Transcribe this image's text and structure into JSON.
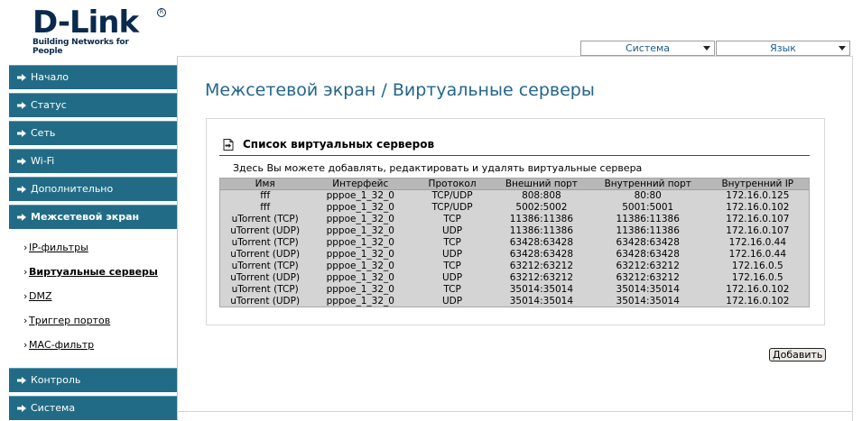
{
  "header": {
    "brand": "D-Link",
    "tagline": "Building Networks for People",
    "system_menu": "Система",
    "language_menu": "Язык"
  },
  "sidebar": {
    "items": [
      {
        "label": "Начало"
      },
      {
        "label": "Статус"
      },
      {
        "label": "Сеть"
      },
      {
        "label": "Wi-Fi"
      },
      {
        "label": "Дополнительно"
      },
      {
        "label": "Межсетевой экран"
      }
    ],
    "subitems": [
      {
        "label": "IP-фильтры"
      },
      {
        "label": "Виртуальные серверы"
      },
      {
        "label": "DMZ"
      },
      {
        "label": "Триггер портов"
      },
      {
        "label": "МАС-фильтр"
      }
    ],
    "bottom_items": [
      {
        "label": "Контроль"
      },
      {
        "label": "Система"
      }
    ]
  },
  "main": {
    "title": "Межсетевой экран /  Виртуальные серверы",
    "section_title": "Список виртуальных серверов",
    "section_desc": "Здесь Вы можете добавлять, редактировать и удалять виртуальные сервера",
    "add_label": "Добавить"
  },
  "table": {
    "columns": [
      "Имя",
      "Интерфейс",
      "Протокол",
      "Внешний порт",
      "Внутренний порт",
      "Внутренний IP"
    ],
    "rows": [
      [
        "fff",
        "pppoe_1_32_0",
        "TCP/UDP",
        "808:808",
        "80:80",
        "172.16.0.125"
      ],
      [
        "fff",
        "pppoe_1_32_0",
        "TCP/UDP",
        "5002:5002",
        "5001:5001",
        "172.16.0.102"
      ],
      [
        "uTorrent (TCP)",
        "pppoe_1_32_0",
        "TCP",
        "11386:11386",
        "11386:11386",
        "172.16.0.107"
      ],
      [
        "uTorrent (UDP)",
        "pppoe_1_32_0",
        "UDP",
        "11386:11386",
        "11386:11386",
        "172.16.0.107"
      ],
      [
        "uTorrent (TCP)",
        "pppoe_1_32_0",
        "TCP",
        "63428:63428",
        "63428:63428",
        "172.16.0.44"
      ],
      [
        "uTorrent (UDP)",
        "pppoe_1_32_0",
        "UDP",
        "63428:63428",
        "63428:63428",
        "172.16.0.44"
      ],
      [
        "uTorrent (TCP)",
        "pppoe_1_32_0",
        "TCP",
        "63212:63212",
        "63212:63212",
        "172.16.0.5"
      ],
      [
        "uTorrent (UDP)",
        "pppoe_1_32_0",
        "UDP",
        "63212:63212",
        "63212:63212",
        "172.16.0.5"
      ],
      [
        "uTorrent (TCP)",
        "pppoe_1_32_0",
        "TCP",
        "35014:35014",
        "35014:35014",
        "172.16.0.102"
      ],
      [
        "uTorrent (UDP)",
        "pppoe_1_32_0",
        "UDP",
        "35014:35014",
        "35014:35014",
        "172.16.0.102"
      ]
    ]
  },
  "colors": {
    "nav_bg": "#216b86",
    "title": "#23668c",
    "brand": "#0a2a4d",
    "table_bg": "#d4d4d4",
    "table_header": "#b8b8b8"
  },
  "icons": {
    "nav_arrow": "arrow-right-icon",
    "section": "document-arrow-icon",
    "dropdown": "chevron-down-icon"
  }
}
